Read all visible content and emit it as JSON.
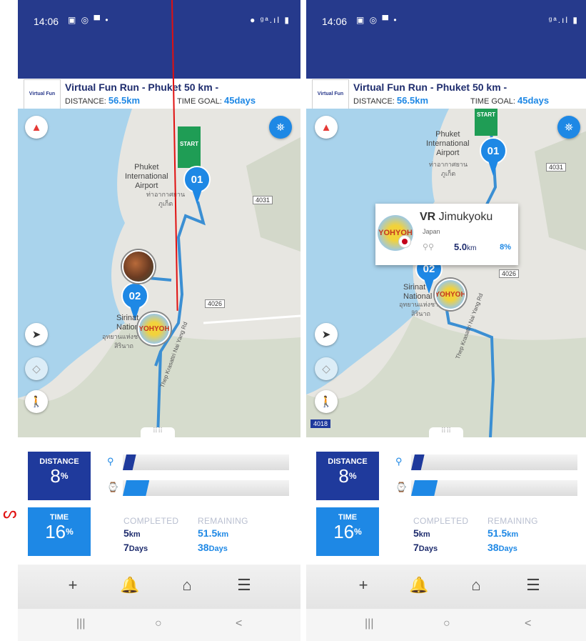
{
  "colors": {
    "header_blue": "#263a8c",
    "accent_blue": "#1e88e5",
    "navy": "#1f3a9c",
    "start_green": "#1f9d55",
    "route_blue": "#3b8fd3"
  },
  "phones": [
    {
      "status": {
        "time": "14:06",
        "left_icons": "▣ ◎ ▀ •",
        "right_icons": "● ᵍᵃ.ıl ▮"
      },
      "event": {
        "title": "Virtual Fun Run - Phuket 50 km -",
        "distance_label": "DISTANCE:",
        "distance_value": "56.5km",
        "time_goal_label": "TIME GOAL:",
        "time_goal_value": "45days",
        "logo_text": "Virtual Fun Run"
      },
      "map": {
        "start_label": "START",
        "pin1": "01",
        "pin2": "02",
        "airport_label": "Phuket\nInternational\nAirport",
        "airport_thai": "ท่าอากาศยาน\nภูเก็ต",
        "park_label": "Sirinat\nNational",
        "park_thai": "อุทยานแห่งชาติ\nสิรินาถ",
        "road_4031": "4031",
        "road_4026": "4026",
        "road_name": "Thep Krasattri Nai Yang Rd",
        "avatar_logo_text": "YOHYOH"
      },
      "stats": {
        "distance_label": "DISTANCE",
        "distance_pct": "8",
        "time_label": "TIME",
        "time_pct": "16",
        "distance_progress": 0.08,
        "time_progress": 0.16,
        "completed_head": "COMPLETED",
        "remaining_head": "REMAINING",
        "completed_km": "5",
        "completed_km_unit": "km",
        "completed_days": "7",
        "completed_days_unit": "Days",
        "remaining_km": "51.5",
        "remaining_km_unit": "km",
        "remaining_days": "38",
        "remaining_days_unit": "Days",
        "percent_sign": "%"
      }
    },
    {
      "status": {
        "time": "14:06",
        "left_icons": "▣ ◎ ▀ •",
        "right_icons": "ᵍᵃ.ıl ▮"
      },
      "event": {
        "title": "Virtual Fun Run - Phuket 50 km -",
        "distance_label": "DISTANCE:",
        "distance_value": "56.5km",
        "time_goal_label": "TIME GOAL:",
        "time_goal_value": "45days",
        "logo_text": "Virtual Fun Run"
      },
      "map": {
        "start_label": "START",
        "pin1": "01",
        "pin2": "02",
        "airport_label": "Phuket\nInternational\nAirport",
        "airport_thai": "ท่าอากาศยาน\nภูเก็ต",
        "park_label": "Sirinat\nNational",
        "park_thai": "อุทยานแห่งชาติ\nสิรินาถ",
        "road_4031": "4031",
        "road_4026": "4026",
        "road_4018": "4018",
        "road_name": "Thep Krasattri Nai Yang Rd",
        "avatar_logo_text": "YOHYOH"
      },
      "popup": {
        "name_bold": "VR",
        "name_rest": " Jimukyoku",
        "country": "Japan",
        "distance": "5.0",
        "distance_unit": "km",
        "percent": "8%",
        "avatar_text": "YOHYOH"
      },
      "stats": {
        "distance_label": "DISTANCE",
        "distance_pct": "8",
        "time_label": "TIME",
        "time_pct": "16",
        "distance_progress": 0.08,
        "time_progress": 0.16,
        "completed_head": "COMPLETED",
        "remaining_head": "REMAINING",
        "completed_km": "5",
        "completed_km_unit": "km",
        "completed_days": "7",
        "completed_days_unit": "Days",
        "remaining_km": "51.5",
        "remaining_km_unit": "km",
        "remaining_days": "38",
        "remaining_days_unit": "Days",
        "percent_sign": "%"
      }
    }
  ],
  "nav": {
    "add_icon": "+",
    "bell_icon": "🔔",
    "home_icon": "⌂",
    "list_icon": "☰"
  },
  "system": {
    "recents": "|||",
    "home": "○",
    "back": "<"
  },
  "annotation": {
    "mark": "ᔕ"
  }
}
